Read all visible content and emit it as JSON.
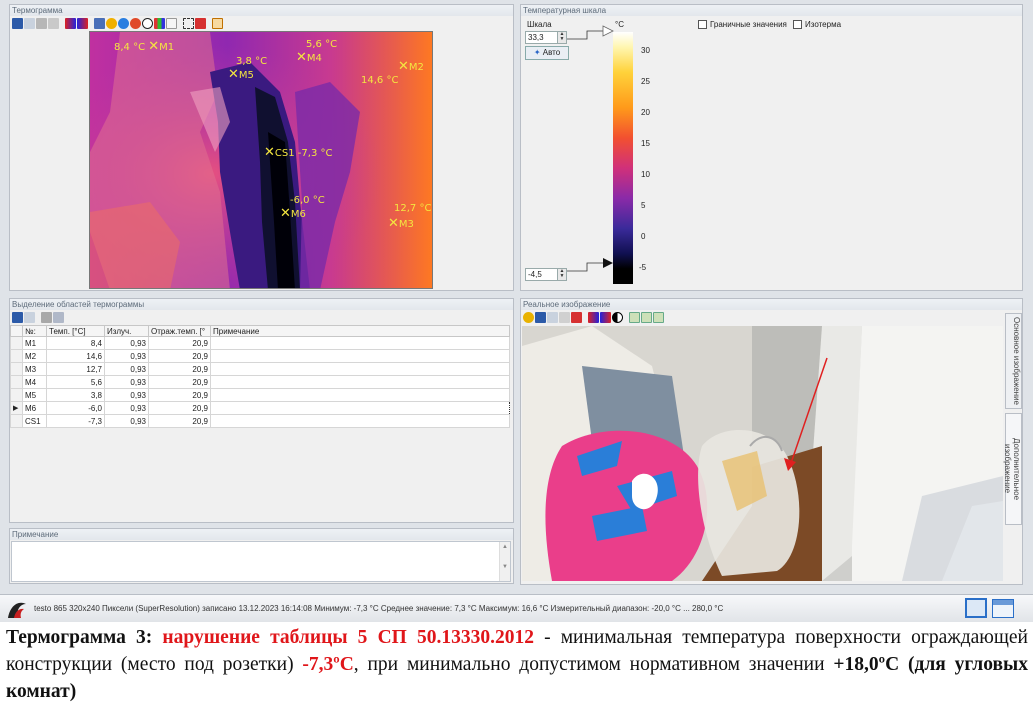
{
  "thermogram": {
    "title": "Термограмма",
    "markers": [
      {
        "id": "M1",
        "label": "8,4 °C",
        "name": "M1"
      },
      {
        "id": "M5",
        "label": "3,8 °C",
        "name": "M5"
      },
      {
        "id": "M4",
        "label": "5,6 °C",
        "name": "M4"
      },
      {
        "id": "M2",
        "label": "14,6 °C",
        "name": "M2"
      },
      {
        "id": "CS1",
        "label": "-7,3 °C",
        "name": "CS1"
      },
      {
        "id": "M6",
        "label": "-6,0 °C",
        "name": "M6"
      },
      {
        "id": "M3",
        "label": "12,7 °C",
        "name": "M3"
      }
    ]
  },
  "scale": {
    "title": "Температурная шкала",
    "scale_label": "Шкала",
    "max_value": "33,3",
    "min_value": "-4,5",
    "auto_button": "Авто",
    "unit": "°C",
    "ticks": [
      "30",
      "25",
      "20",
      "15",
      "10",
      "5",
      "0",
      "-5"
    ],
    "boundary_values": "Граничные значения",
    "isotherm": "Изотерма"
  },
  "regions": {
    "title": "Выделение областей термограммы",
    "columns": [
      "№:",
      "Темп. [°C]",
      "Излуч.",
      "Отраж.темп. [°",
      "Примечание"
    ],
    "rows": [
      {
        "id": "M1",
        "temp": "8,4",
        "emis": "0,93",
        "refl": "20,9",
        "note": ""
      },
      {
        "id": "M2",
        "temp": "14,6",
        "emis": "0,93",
        "refl": "20,9",
        "note": ""
      },
      {
        "id": "M3",
        "temp": "12,7",
        "emis": "0,93",
        "refl": "20,9",
        "note": ""
      },
      {
        "id": "M4",
        "temp": "5,6",
        "emis": "0,93",
        "refl": "20,9",
        "note": ""
      },
      {
        "id": "M5",
        "temp": "3,8",
        "emis": "0,93",
        "refl": "20,9",
        "note": ""
      },
      {
        "id": "M6",
        "temp": "-6,0",
        "emis": "0,93",
        "refl": "20,9",
        "note": ""
      },
      {
        "id": "CS1",
        "temp": "-7,3",
        "emis": "0,93",
        "refl": "20,9",
        "note": ""
      }
    ]
  },
  "note": {
    "title": "Примечание"
  },
  "real_image": {
    "title": "Реальное изображение",
    "tab_main": "Основное изображение",
    "tab_extra": "Дополнительное изображение"
  },
  "status": {
    "text": "testo 865 320x240 Пиксели (SuperResolution) записано 13.12.2023 16:14:08 Минимум: -7,3 °C Среднее значение: 7,3 °C Максимум: 16,6 °C Измерительный диапазон: -20,0 °C ... 280,0 °C"
  },
  "caption": {
    "part1": "Термограмма  3: ",
    "part2": "нарушение таблицы 5 СП 50.13330.2012",
    "part3": " - минимальная температура поверхности ограждающей конструкции (место под розетки) ",
    "part4": "-7,3ºС",
    "part5": ", при минимально допустимом нормативном значении ",
    "part6": "+18,0ºС (для угловых комнат)"
  }
}
